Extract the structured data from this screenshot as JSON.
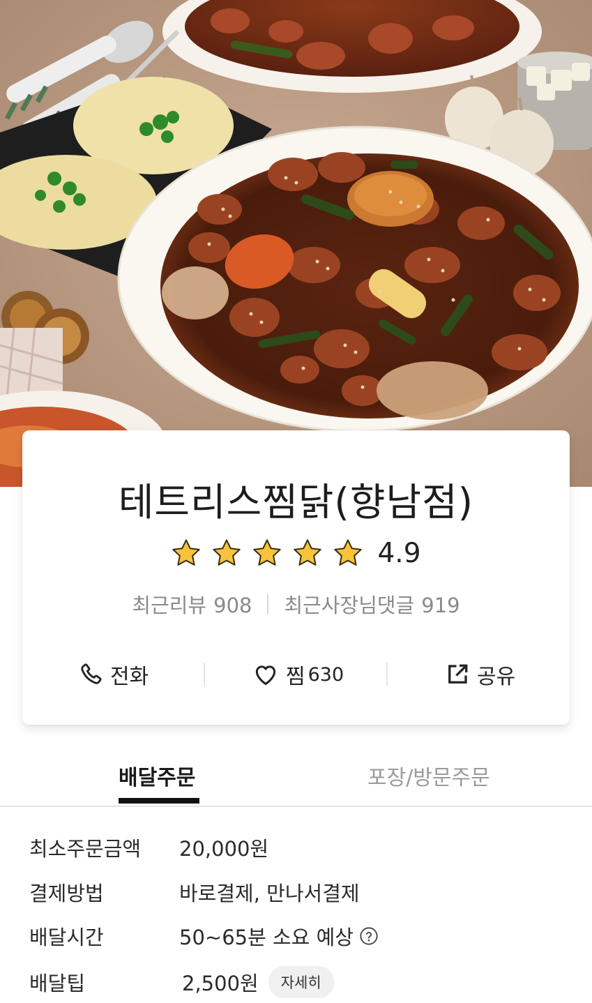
{
  "store": {
    "name": "테트리스찜닭(향남점)",
    "rating": "4.9",
    "rating_stars": 5,
    "recent_reviews_label": "최근리뷰",
    "recent_reviews_count": "908",
    "owner_replies_label": "최근사장님댓글",
    "owner_replies_count": "919"
  },
  "actions": {
    "call_label": "전화",
    "favorite_label": "찜",
    "favorite_count": "630",
    "share_label": "공유"
  },
  "tabs": {
    "delivery": "배달주문",
    "pickup": "포장/방문주문"
  },
  "details": {
    "min_order_label": "최소주문금액",
    "min_order_value": "20,000원",
    "payment_label": "결제방법",
    "payment_value": "바로결제, 만나서결제",
    "delivery_time_label": "배달시간",
    "delivery_time_value": "50~65분 소요 예상",
    "delivery_tip_label": "배달팁",
    "delivery_tip_value": "2,500원",
    "detail_button": "자세히"
  },
  "colors": {
    "star": "#f7c33b",
    "text_dark": "#222222",
    "text_muted": "#8a8a8a",
    "tab_underline": "#111111"
  },
  "icons": [
    "phone-icon",
    "heart-icon",
    "share-icon",
    "star-icon",
    "help-icon"
  ]
}
